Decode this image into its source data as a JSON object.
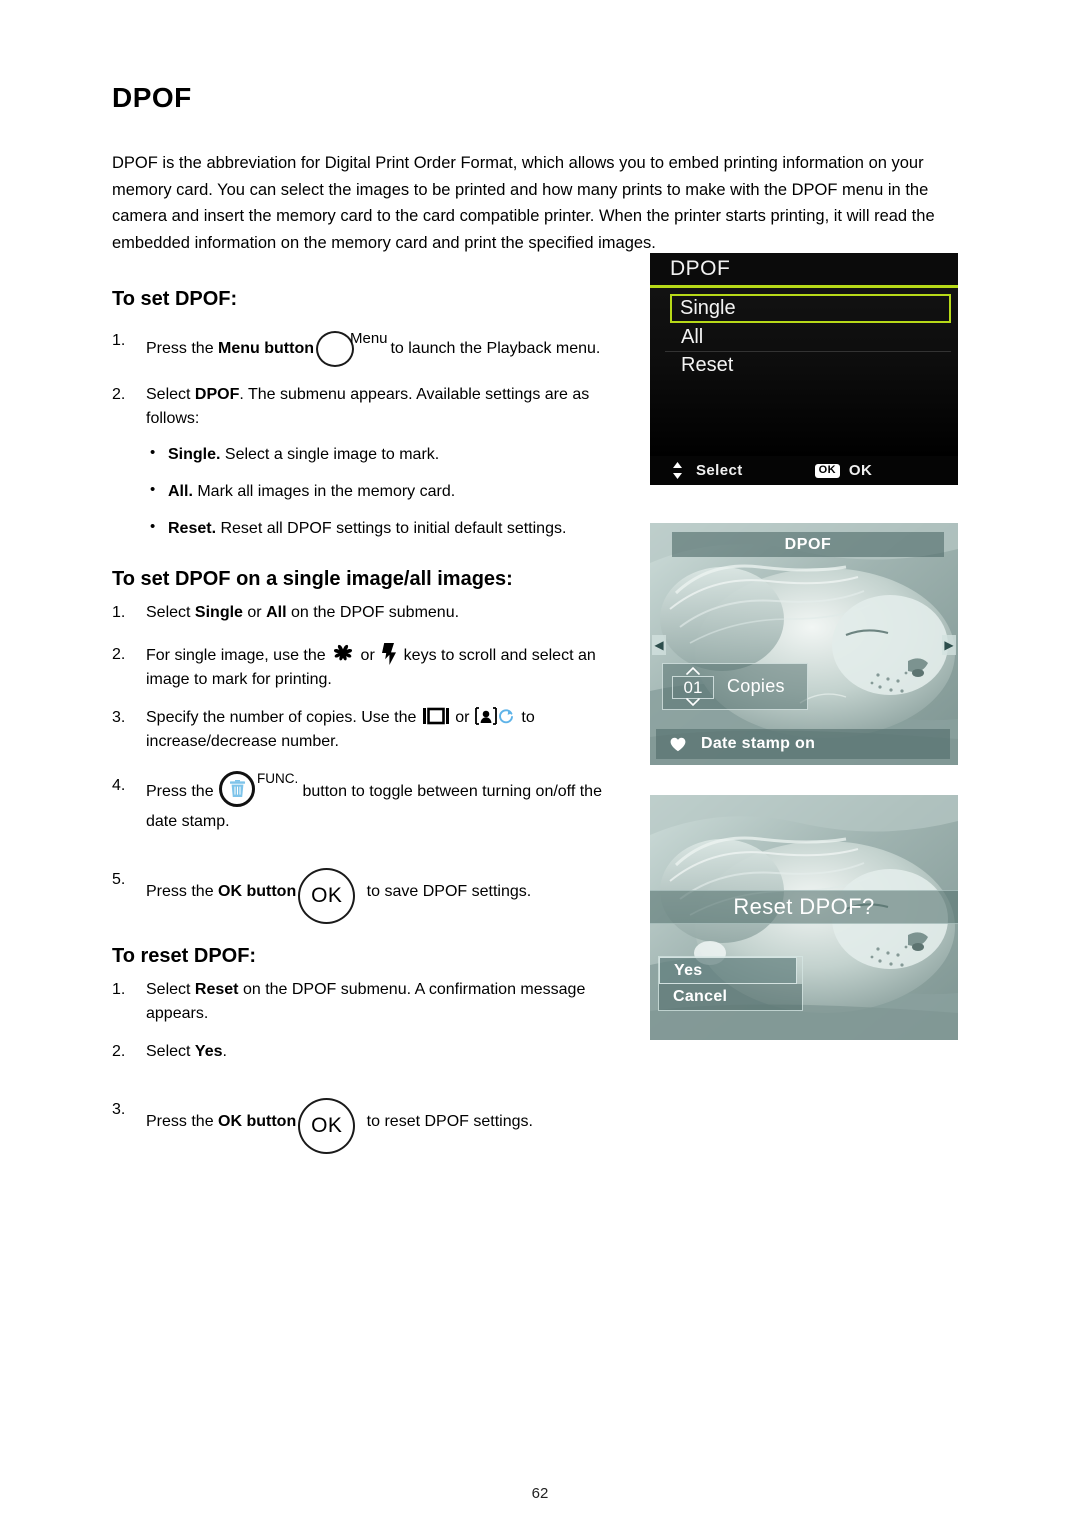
{
  "document": {
    "title": "DPOF",
    "intro": "DPOF is the abbreviation for Digital Print Order Format, which allows you to embed printing information on your memory card. You can select the images to be printed and how many prints to make with the DPOF menu in the camera and insert the memory card to the card compatible printer. When the printer starts printing, it will read the embedded information on the memory card and print the specified images.",
    "page_number": "62"
  },
  "section_set": {
    "heading": "To set DPOF:",
    "step1": {
      "num": "1.",
      "text_before": "Press the ",
      "bold": "Menu button",
      "button_label": "Menu",
      "text_after": " to launch the Playback menu."
    },
    "step2": {
      "num": "2.",
      "text_before": "Select ",
      "bold": "DPOF",
      "text_after": ". The submenu appears. Available settings are as follows:"
    },
    "bullets": [
      {
        "bold": "Single.",
        "text": " Select a single image to mark."
      },
      {
        "bold": "All.",
        "text": " Mark all images in the memory card."
      },
      {
        "bold": "Reset.",
        "text": " Reset all DPOF settings to initial default settings."
      }
    ]
  },
  "section_single": {
    "heading": "To set DPOF on a single image/all images:",
    "step1": {
      "num": "1.",
      "a": "Select ",
      "b1": "Single",
      "b": " or ",
      "b2": "All",
      "c": " on the DPOF submenu."
    },
    "step2": {
      "num": "2.",
      "a": "For single image, use the ",
      "icon1": "macro-icon",
      "b": " or ",
      "icon2": "flash-icon",
      "c": " keys to scroll and select an image to mark for printing."
    },
    "step3": {
      "num": "3.",
      "a": "Specify the number of copies. Use the ",
      "icon1": "display-icon",
      "b": " or ",
      "icon2": "self-timer-icon",
      "icon3": "rotate-icon",
      "c": " to increase/decrease number."
    },
    "step4": {
      "num": "4.",
      "a": "Press the ",
      "button_label": "FUNC.",
      "button_icon": "trash-icon",
      "c": " button to toggle between turning on/off the date stamp."
    },
    "step5": {
      "num": "5.",
      "a": "Press the ",
      "bold": "OK button",
      "button_label": "OK",
      "c": " to save DPOF settings."
    }
  },
  "section_reset": {
    "heading": "To reset DPOF:",
    "step1": {
      "num": "1.",
      "a": "Select ",
      "bold": "Reset",
      "c": " on the DPOF submenu. A confirmation message appears."
    },
    "step2": {
      "num": "2.",
      "a": "Select ",
      "bold": "Yes",
      "c": "."
    },
    "step3": {
      "num": "3.",
      "a": "Press the ",
      "bold": "OK button",
      "button_label": "OK",
      "c": " to reset DPOF settings."
    }
  },
  "screens": {
    "dpof_menu": {
      "title": "DPOF",
      "items": [
        {
          "label": "Single",
          "selected": true
        },
        {
          "label": "All",
          "selected": false
        },
        {
          "label": "Reset",
          "selected": false
        }
      ],
      "footer": {
        "select_label": "Select",
        "ok_badge": "OK",
        "ok_label": "OK"
      },
      "highlight_color": "#b7d918",
      "background_color": "#000000"
    },
    "dpof_copies": {
      "title": "DPOF",
      "copies_value": "01",
      "copies_label": "Copies",
      "date_stamp_label": "Date stamp on",
      "nav_left": "◀",
      "nav_right": "▶",
      "osd_color": "#506c6a"
    },
    "dpof_reset": {
      "banner": "Reset DPOF?",
      "options": [
        {
          "label": "Yes",
          "selected": true
        },
        {
          "label": "Cancel",
          "selected": false
        }
      ]
    }
  }
}
